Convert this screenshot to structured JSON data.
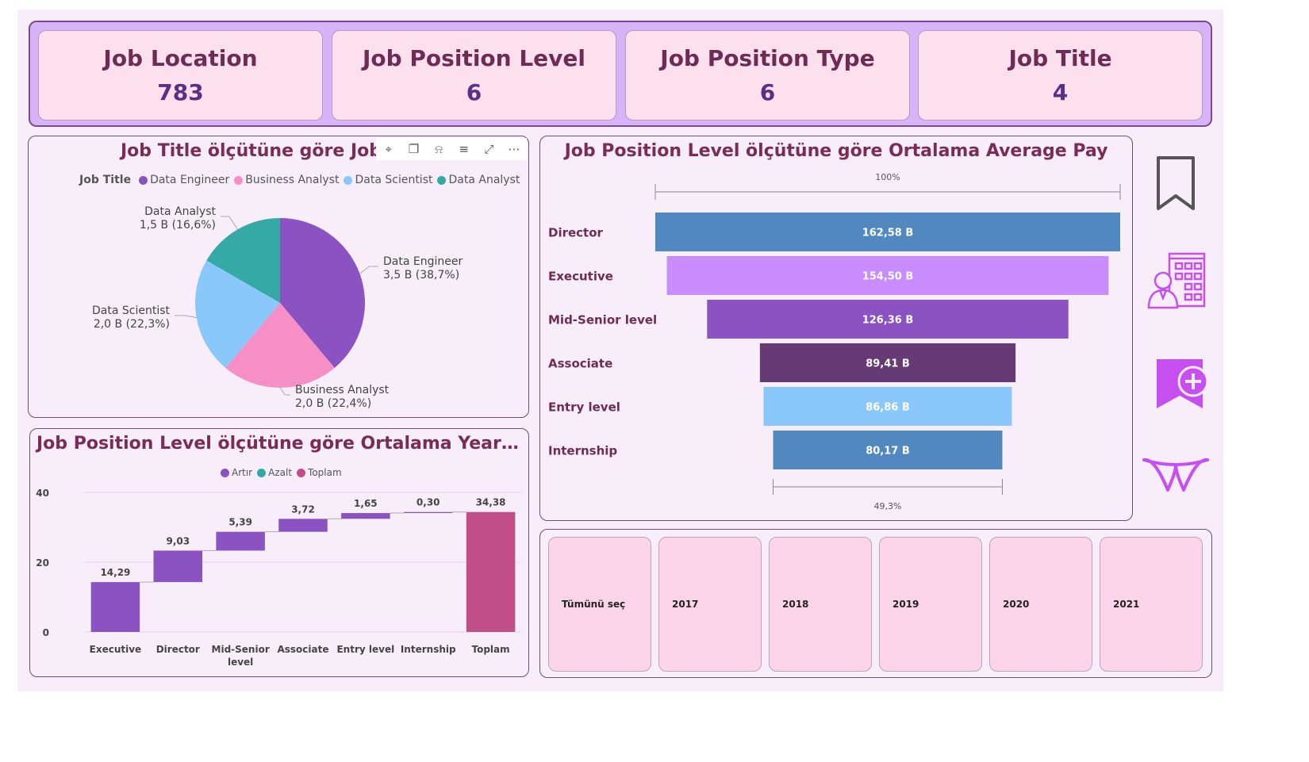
{
  "kpis": [
    {
      "label": "Job Location",
      "value": "783"
    },
    {
      "label": "Job Position Level",
      "value": "6"
    },
    {
      "label": "Job Position Type",
      "value": "6"
    },
    {
      "label": "Job Title",
      "value": "4"
    }
  ],
  "pie_panel": {
    "title": "Job Title ölçütüne göre Job Titl",
    "title_tail": "y",
    "toolbar": [
      "pin-icon",
      "copy-icon",
      "bell-icon",
      "filter-icon",
      "focus-icon",
      "more-icon"
    ]
  },
  "waterfall_panel": {
    "title": "Job Position Level ölçütüne göre Ortalama Years of Expe..."
  },
  "funnel_panel": {
    "title": "Job Position Level ölçütüne göre Ortalama Average Pay",
    "top_pct": "100%",
    "bottom_pct": "49,3%"
  },
  "slicer": {
    "options": [
      "Tümünü seç",
      "2017",
      "2018",
      "2019",
      "2020",
      "2021"
    ]
  },
  "side_icons": [
    "bookmark-icon",
    "employee-building-icon",
    "add-comment-icon",
    "logo-icon"
  ],
  "colors": {
    "accent": "#7a2b57",
    "kpi_bg": "#fde0ee",
    "kpi_strip": "#d7b4f7",
    "purple": "#8b52c1",
    "teal": "#34a9a6",
    "pink": "#f68fc6",
    "lightblue": "#8ac8fb",
    "plum": "#c04f88",
    "icon": "#c84fef"
  },
  "chart_data": [
    {
      "type": "pie",
      "legend_title": "Job Title",
      "labels": [
        "Data Engineer",
        "Business Analyst",
        "Data Scientist",
        "Data Analyst"
      ],
      "colors": [
        "#8b52c1",
        "#f68fc6",
        "#8ac8fb",
        "#34a9a6"
      ],
      "values": [
        3.5,
        2.0,
        2.0,
        1.5
      ],
      "value_labels": [
        "3,5 B (38,7%)",
        "2,0 B (22,4%)",
        "2,0 B (22,3%)",
        "1,5 B (16,6%)"
      ],
      "percentages": [
        38.7,
        22.4,
        22.3,
        16.6
      ]
    },
    {
      "type": "bar",
      "subtype": "waterfall",
      "legend": [
        {
          "name": "Artır",
          "color": "#8b52c1"
        },
        {
          "name": "Azalt",
          "color": "#34a9a6"
        },
        {
          "name": "Toplam",
          "color": "#c04f88"
        }
      ],
      "categories": [
        "Executive",
        "Director",
        "Mid-Senior level",
        "Associate",
        "Entry level",
        "Internship",
        "Toplam"
      ],
      "category_lines": [
        [
          "Executive"
        ],
        [
          "Director"
        ],
        [
          "Mid-Senior",
          "level"
        ],
        [
          "Associate"
        ],
        [
          "Entry level"
        ],
        [
          "Internship"
        ],
        [
          "Toplam"
        ]
      ],
      "values": [
        14.29,
        9.03,
        5.39,
        3.72,
        1.65,
        0.3,
        34.38
      ],
      "value_labels": [
        "14,29",
        "9,03",
        "5,39",
        "3,72",
        "1,65",
        "0,30",
        "34,38"
      ],
      "kinds": [
        "inc",
        "inc",
        "inc",
        "inc",
        "inc",
        "inc",
        "total"
      ],
      "y_ticks": [
        0,
        20,
        40
      ],
      "ylim": [
        0,
        40
      ]
    },
    {
      "type": "bar",
      "subtype": "funnel",
      "categories": [
        "Director",
        "Executive",
        "Mid-Senior level",
        "Associate",
        "Entry level",
        "Internship"
      ],
      "values": [
        162.58,
        154.5,
        126.36,
        89.41,
        86.86,
        80.17
      ],
      "value_labels": [
        "162,58 B",
        "154,50 B",
        "126,36 B",
        "89,41 B",
        "86,86 B",
        "80,17 B"
      ],
      "colors": [
        "#5288c0",
        "#c98cfd",
        "#8b52c1",
        "#663a74",
        "#8ac8fb",
        "#5288c0"
      ]
    }
  ]
}
